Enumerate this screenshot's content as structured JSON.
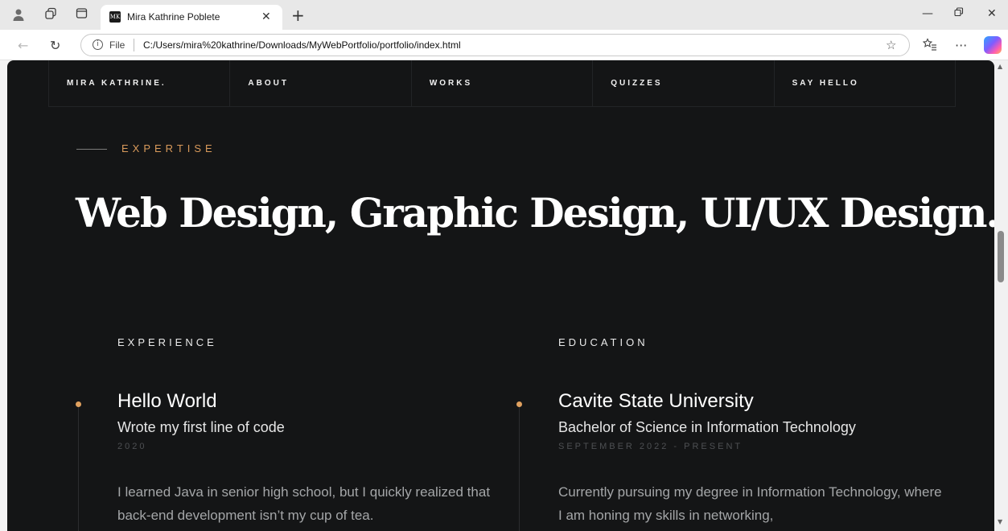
{
  "browser": {
    "tab_title": "Mira Kathrine Poblete",
    "tab_favicon_text": "MK",
    "scheme_label": "File",
    "url": "C:/Users/mira%20kathrine/Downloads/MyWebPortfolio/portfolio/index.html"
  },
  "site": {
    "nav": [
      "MIRA KATHRINE.",
      "ABOUT",
      "WORKS",
      "QUIZZES",
      "SAY HELLO"
    ],
    "expertise": {
      "eyebrow": "EXPERTISE",
      "headline": "Web Design, Graphic Design, UI/UX Design."
    },
    "experience": {
      "heading": "EXPERIENCE",
      "title": "Hello World",
      "subtitle": "Wrote my first line of code",
      "date": "2020",
      "body": "I learned Java in senior high school, but I quickly realized that back-end development isn’t my cup of tea."
    },
    "education": {
      "heading": "EDUCATION",
      "title": "Cavite State University",
      "subtitle": "Bachelor of Science in Information Technology",
      "date": "SEPTEMBER 2022 - PRESENT",
      "body": "Currently pursuing my degree in Information Technology, where I am honing my skills in networking,"
    }
  },
  "colors": {
    "page_background": "#141516",
    "accent": "#d99a5b",
    "timeline_dot": "#e0a15f"
  }
}
